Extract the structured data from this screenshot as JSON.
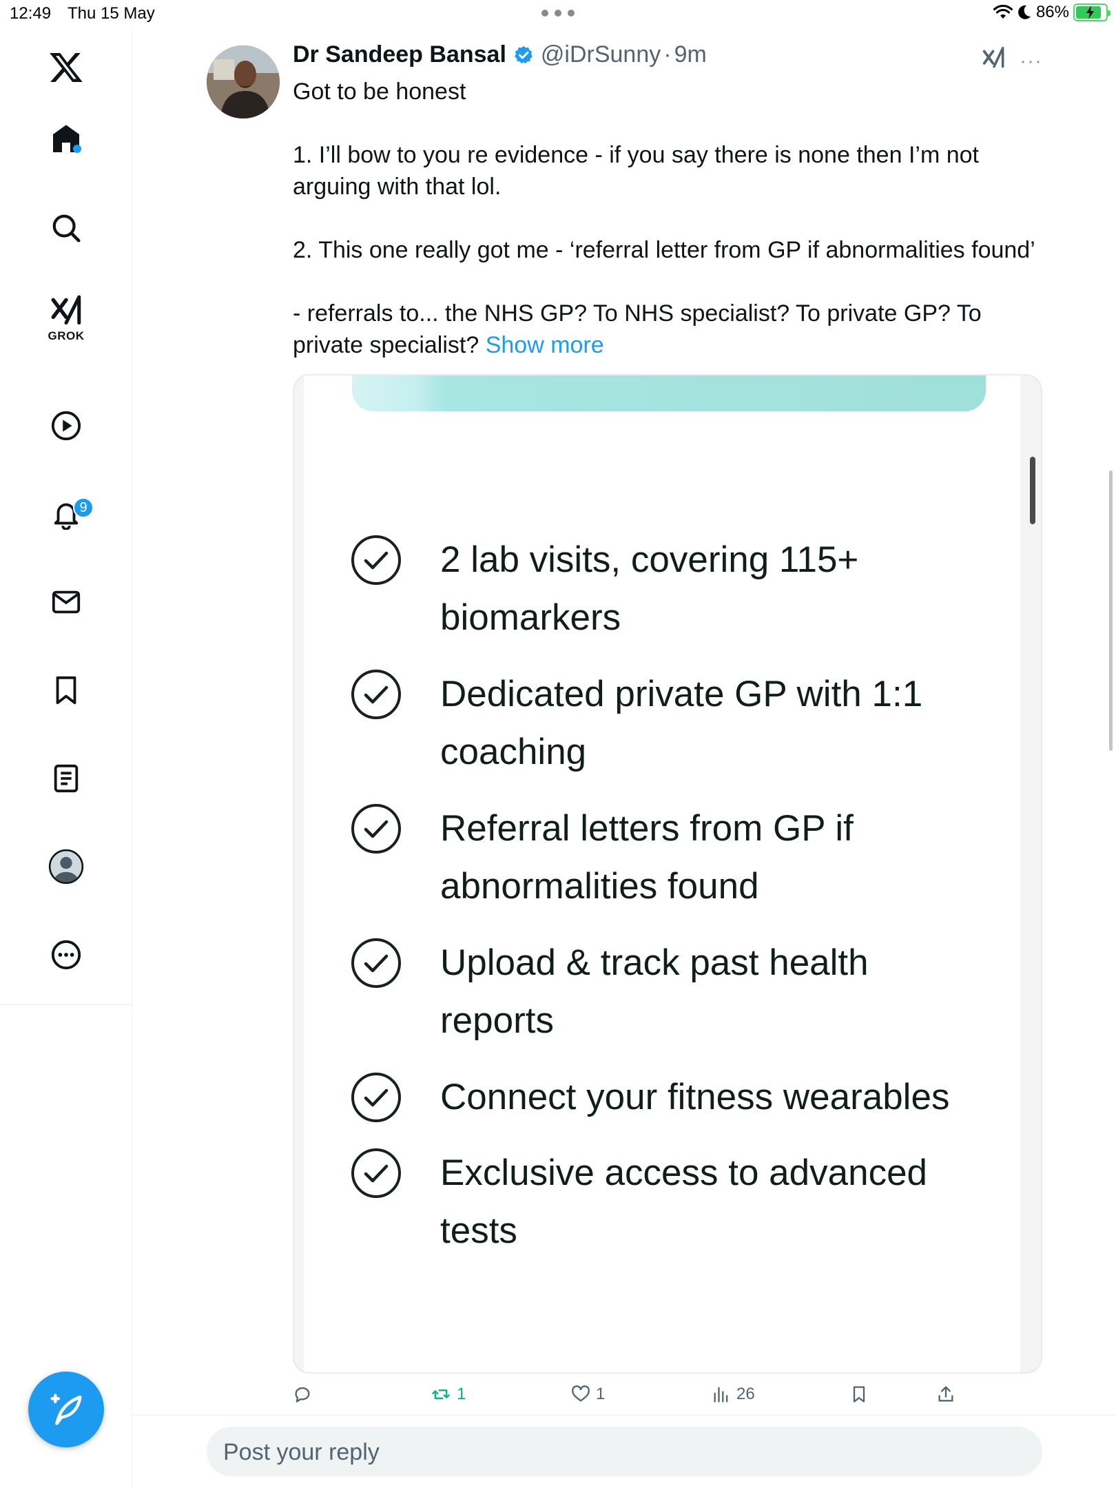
{
  "status_bar": {
    "time": "12:49",
    "date": "Thu 15 May",
    "battery": "86%"
  },
  "sidebar": {
    "items": [
      {
        "name": "x-logo"
      },
      {
        "name": "home",
        "has_dot": true
      },
      {
        "name": "search"
      },
      {
        "name": "grok",
        "label": "GROK"
      },
      {
        "name": "video"
      },
      {
        "name": "notifications",
        "badge": "9"
      },
      {
        "name": "messages"
      },
      {
        "name": "bookmarks"
      },
      {
        "name": "lists"
      },
      {
        "name": "profile"
      },
      {
        "name": "more"
      }
    ]
  },
  "tweet": {
    "author_name": "Dr Sandeep Bansal",
    "handle": "@iDrSunny",
    "separator": "·",
    "time": "9m",
    "lines": [
      "Got to be honest",
      "1. I’ll bow to you re evidence - if you say there is none then I’m not",
      "arguing with that lol.",
      "2. This one really got me - ‘referral letter from GP if abnormalities found’",
      "- referrals to... the NHS GP? To NHS specialist?  To private GP? To",
      "private specialist?"
    ],
    "show_more": "Show more",
    "more_menu": "···"
  },
  "media": {
    "features": [
      [
        "2 lab visits, covering 115+",
        "biomarkers"
      ],
      [
        "Dedicated private GP with 1:1",
        "coaching"
      ],
      [
        "Referral letters from GP if",
        "abnormalities found"
      ],
      [
        "Upload & track past health",
        "reports"
      ],
      [
        "Connect your fitness wearables"
      ],
      [
        "Exclusive access to advanced",
        "tests"
      ]
    ]
  },
  "actions": {
    "reposts": "1",
    "likes": "1",
    "views": "26"
  },
  "reply": {
    "placeholder": "Post your reply"
  },
  "colors": {
    "accent": "#1d9bf0",
    "repost_green": "#00ba7c",
    "text": "#0f1419",
    "muted": "#536471"
  }
}
